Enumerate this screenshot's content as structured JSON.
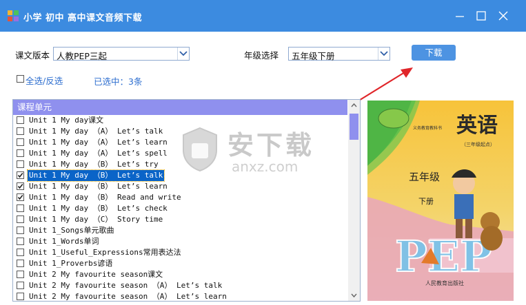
{
  "window": {
    "title": "小学 初中 高中课文音频下载",
    "controls": {
      "minimize_icon": "minimize-icon",
      "maximize_icon": "maximize-icon",
      "close_icon": "close-icon"
    }
  },
  "toolbar": {
    "edition_label": "课文版本",
    "edition_value": "人教PEP三起",
    "grade_label": "年级选择",
    "grade_value": "五年级下册",
    "download_label": "下载",
    "select_all_label": "全选/反选",
    "selected_count_text": "已选中：3条"
  },
  "list": {
    "header": "课程单元",
    "rows": [
      {
        "text": "Unit 1 My day课文",
        "checked": false,
        "selected": false
      },
      {
        "text": "Unit 1 My day （A） Let’s talk",
        "checked": false,
        "selected": false
      },
      {
        "text": "Unit 1 My day （A） Let’s learn",
        "checked": false,
        "selected": false
      },
      {
        "text": "Unit 1 My day （A） Let’s spell",
        "checked": false,
        "selected": false
      },
      {
        "text": "Unit 1 My day （B） Let’s try",
        "checked": false,
        "selected": false
      },
      {
        "text": "Unit 1 My day （B） Let’s talk",
        "checked": true,
        "selected": true
      },
      {
        "text": "Unit 1 My day （B） Let’s learn",
        "checked": true,
        "selected": false
      },
      {
        "text": "Unit 1 My day （B） Read and write",
        "checked": true,
        "selected": false
      },
      {
        "text": "Unit 1 My day （B） Let’s check",
        "checked": false,
        "selected": false
      },
      {
        "text": "Unit 1 My day （C） Story time",
        "checked": false,
        "selected": false
      },
      {
        "text": "Unit 1_Songs单元歌曲",
        "checked": false,
        "selected": false
      },
      {
        "text": "Unit 1_Words单词",
        "checked": false,
        "selected": false
      },
      {
        "text": "Unit 1_Useful_Expressions常用表达法",
        "checked": false,
        "selected": false
      },
      {
        "text": "Unit 1_Proverbs谚语",
        "checked": false,
        "selected": false
      },
      {
        "text": "Unit 2 My favourite season课文",
        "checked": false,
        "selected": false
      },
      {
        "text": "Unit 2 My favourite season （A） Let’s talk",
        "checked": false,
        "selected": false
      },
      {
        "text": "Unit 2 My favourite season （A） Let’s learn",
        "checked": false,
        "selected": false
      }
    ]
  },
  "book_cover": {
    "title": "英语",
    "subtitle": "（三年级起点）",
    "series": "义务教育教科书",
    "grade": "五年级",
    "volume": "下册",
    "logo": "PEP",
    "publisher": "人民教育出版社"
  },
  "watermark": {
    "text_cn": "安下载",
    "text_en": "anxz.com",
    "icon": "shield-icon"
  },
  "colors": {
    "titlebar": "#3c8be0",
    "list_header": "#8f90ee",
    "selection": "#0a64c8",
    "download_button": "#4d93e2",
    "arrow": "#e0262a"
  }
}
